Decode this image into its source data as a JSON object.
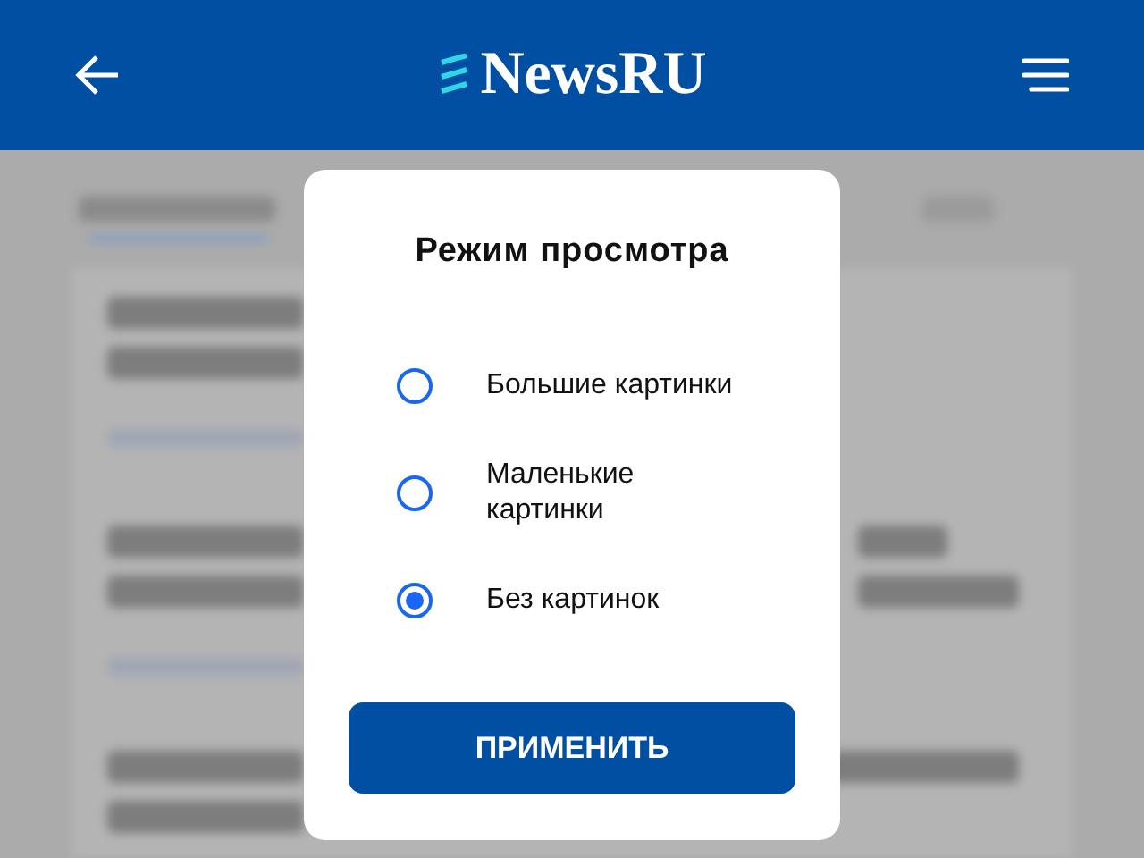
{
  "header": {
    "logo": "NewsRU"
  },
  "dialog": {
    "title": "Режим просмотра",
    "options": [
      {
        "label": "Большие картинки",
        "selected": false
      },
      {
        "label": "Маленькие картинки",
        "selected": false
      },
      {
        "label": "Без картинок",
        "selected": true
      }
    ],
    "apply_button": "ПРИМЕНИТЬ"
  }
}
